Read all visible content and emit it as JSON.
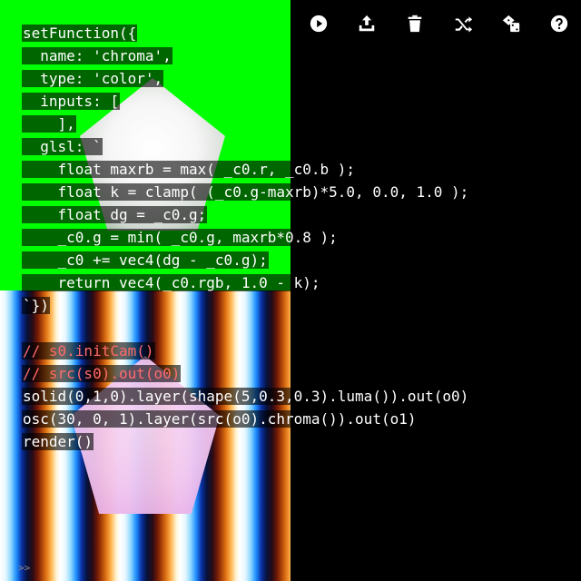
{
  "toolbar": {
    "buttons": [
      {
        "name": "run",
        "icon": "play-circle-icon"
      },
      {
        "name": "upload",
        "icon": "upload-icon"
      },
      {
        "name": "clear",
        "icon": "trash-icon"
      },
      {
        "name": "shuffle",
        "icon": "shuffle-icon"
      },
      {
        "name": "random",
        "icon": "dice-icon"
      },
      {
        "name": "help",
        "icon": "help-circle-icon"
      }
    ]
  },
  "code": {
    "lines": [
      "setFunction({",
      "  name: 'chroma',",
      "  type: 'color',",
      "  inputs: [",
      "    ],",
      "  glsl: `",
      "    float maxrb = max( _c0.r, _c0.b );",
      "    float k = clamp( (_c0.g-maxrb)*5.0, 0.0, 1.0 );",
      "    float dg = _c0.g;",
      "    _c0.g = min( _c0.g, maxrb*0.8 );",
      "    _c0 += vec4(dg - _c0.g);",
      "    return vec4(_c0.rgb, 1.0 - k);",
      "`})",
      "",
      "// s0.initCam()",
      "// src(s0).out(o0)",
      "solid(0,1,0).layer(shape(5,0.3,0.3).luma()).out(o0)",
      "osc(30, 0, 1).layer(src(o0).chroma()).out(o1)",
      "render()"
    ]
  },
  "console": {
    "prompt": ">>"
  },
  "colors": {
    "green": "#00ff00",
    "string": "#ffd88a",
    "comment": "#ff6b6b",
    "number": "#c9a0ff"
  }
}
